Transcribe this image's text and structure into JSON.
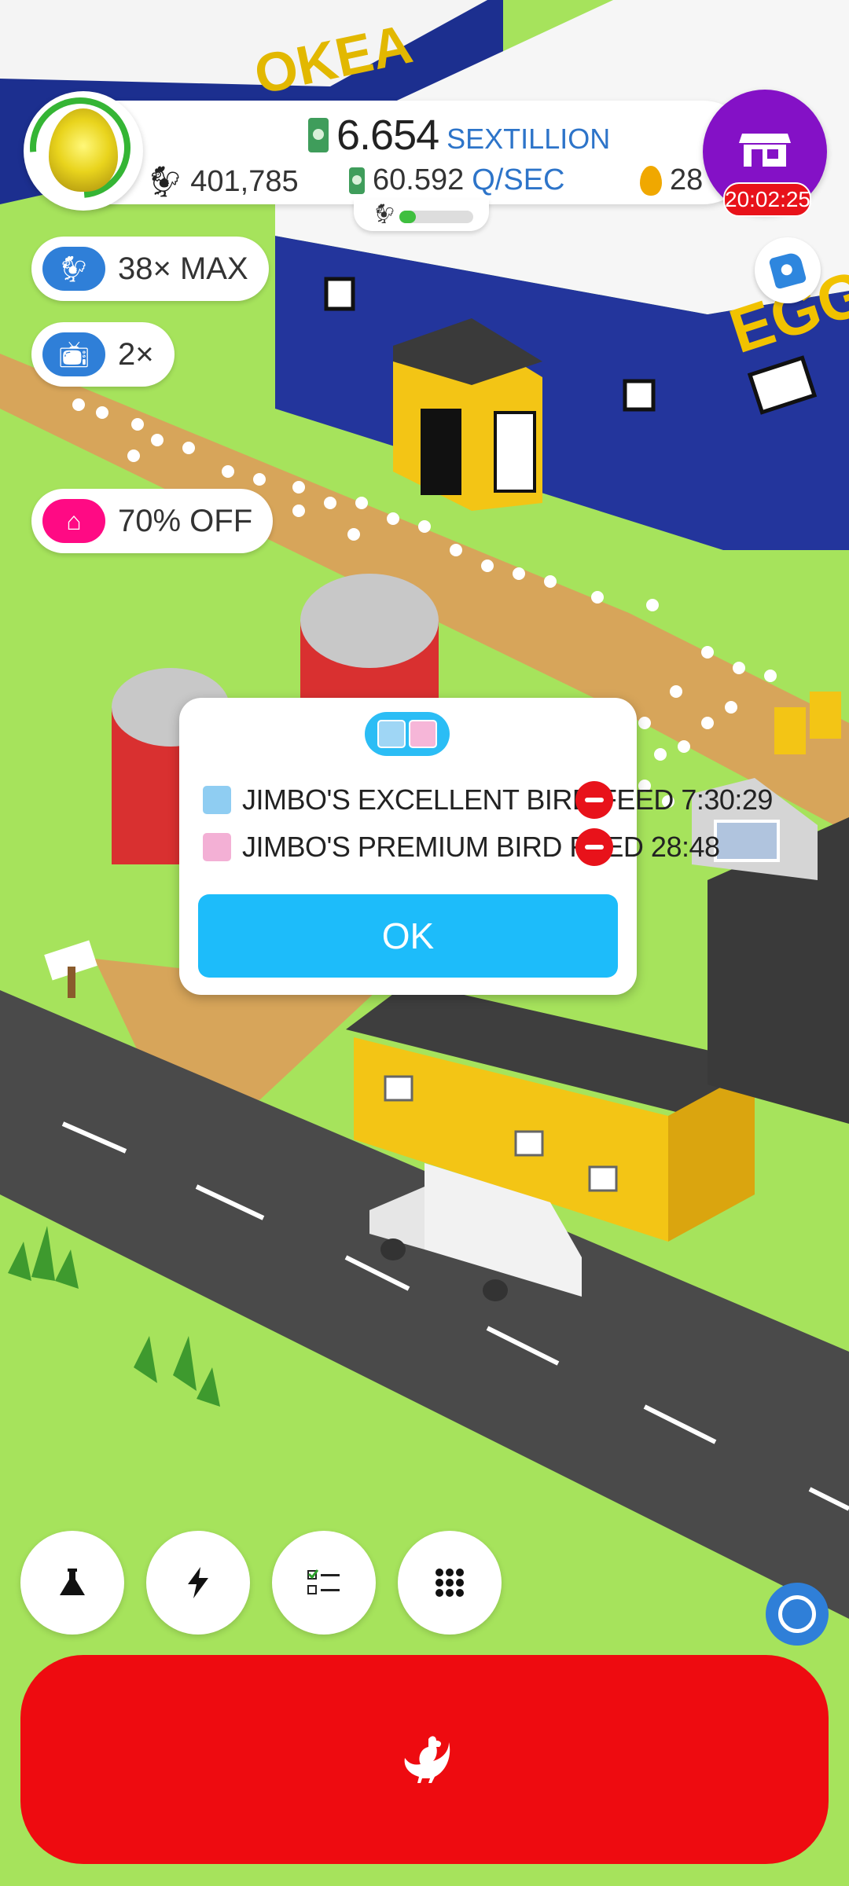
{
  "hud": {
    "money_value": "6.654",
    "money_unit": "SEXTILLION",
    "rate_value": "60.592",
    "rate_unit": "Q/SEC",
    "chicken_count": "401,785",
    "golden_eggs": "28",
    "habitat_progress": 0.22
  },
  "shop": {
    "timer": "20:02:25",
    "icon": "store-icon"
  },
  "boost_pills": [
    {
      "label": "38× MAX",
      "icon": "chicken-icon",
      "color": "#2f7fd8"
    },
    {
      "label": "2×",
      "icon": "tv-icon",
      "color": "#2f7fd8"
    },
    {
      "label": "70% OFF",
      "icon": "house-icon",
      "color": "#ff0a84"
    }
  ],
  "modal": {
    "boosts": [
      {
        "label": "JIMBO'S EXCELLENT BIRD FEED 7:30:29",
        "icon": "feed-bag-blue-icon"
      },
      {
        "label": "JIMBO'S PREMIUM BIRD FEED 28:48",
        "icon": "feed-bag-pink-icon"
      }
    ],
    "ok_label": "OK"
  },
  "bottom_buttons": [
    {
      "icon": "flask-icon"
    },
    {
      "icon": "lightning-icon"
    },
    {
      "icon": "checklist-icon"
    },
    {
      "icon": "grid-menu-icon"
    }
  ],
  "colors": {
    "grass": "#a6e35c",
    "accent_blue": "#1dbcfa",
    "hatch_red": "#ee0b10",
    "shop_purple": "#8411c6"
  }
}
